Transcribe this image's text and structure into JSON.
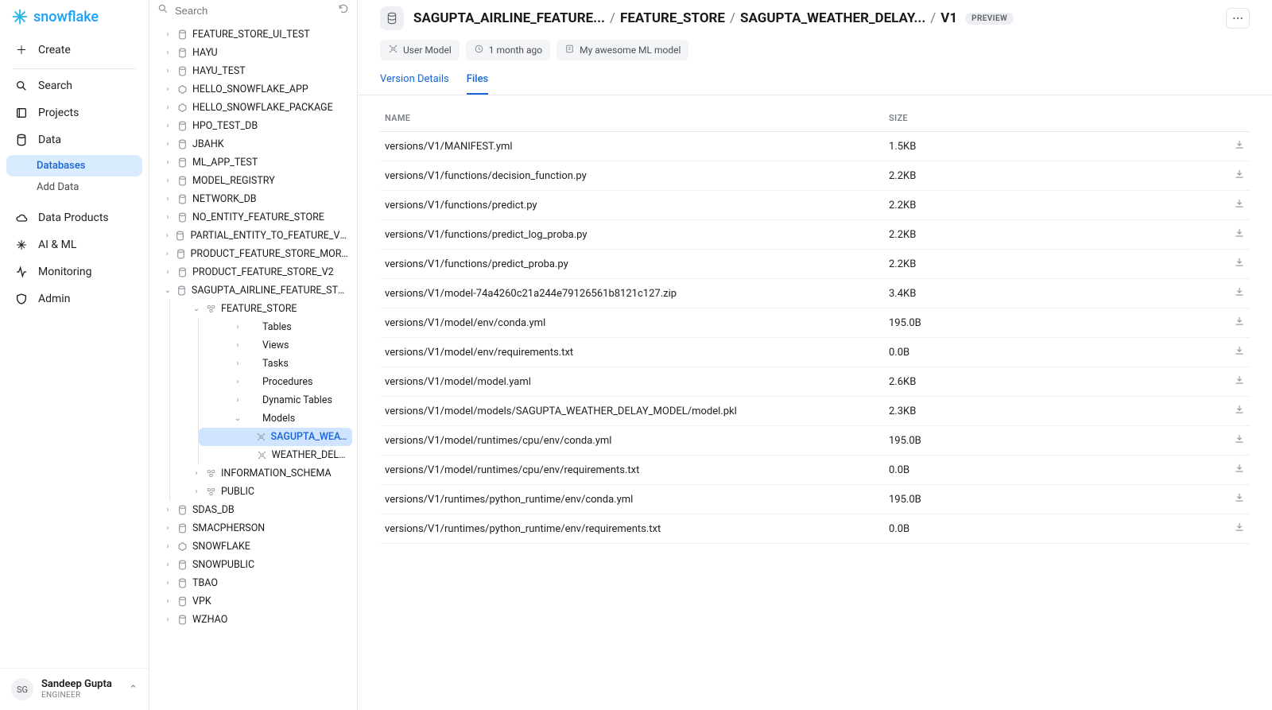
{
  "brand": "snowflake",
  "leftnav": {
    "create": "Create",
    "items": [
      {
        "label": "Search",
        "icon": "search"
      },
      {
        "label": "Projects",
        "icon": "projects"
      },
      {
        "label": "Data",
        "icon": "database"
      },
      {
        "label": "Data Products",
        "icon": "cloud"
      },
      {
        "label": "AI & ML",
        "icon": "sparkle"
      },
      {
        "label": "Monitoring",
        "icon": "activity"
      },
      {
        "label": "Admin",
        "icon": "shield"
      }
    ],
    "data_sub": [
      {
        "label": "Databases",
        "active": true
      },
      {
        "label": "Add Data",
        "active": false
      }
    ]
  },
  "user": {
    "initials": "SG",
    "name": "Sandeep Gupta",
    "role": "ENGINEER"
  },
  "tree": {
    "search_placeholder": "Search",
    "databases": [
      "FEATURE_STORE_UI_TEST",
      "HAYU",
      "HAYU_TEST",
      "HELLO_SNOWFLAKE_APP",
      "HELLO_SNOWFLAKE_PACKAGE",
      "HPO_TEST_DB",
      "JBAHK",
      "ML_APP_TEST",
      "MODEL_REGISTRY",
      "NETWORK_DB",
      "NO_ENTITY_FEATURE_STORE",
      "PARTIAL_ENTITY_TO_FEATURE_VIEW_LI...",
      "PRODUCT_FEATURE_STORE_MORE_ENT...",
      "PRODUCT_FEATURE_STORE_V2"
    ],
    "expanded_db": "SAGUPTA_AIRLINE_FEATURE_STORE",
    "schema": "FEATURE_STORE",
    "schema_children": [
      "Tables",
      "Views",
      "Tasks",
      "Procedures",
      "Dynamic Tables"
    ],
    "models_label": "Models",
    "models": {
      "selected": "SAGUPTA_WEATHER_DELAY_...",
      "other": "WEATHER_DELAY_MODEL"
    },
    "other_schemas": [
      "INFORMATION_SCHEMA",
      "PUBLIC"
    ],
    "databases_after": [
      "SDAS_DB",
      "SMACPHERSON",
      "SNOWFLAKE",
      "SNOWPUBLIC",
      "TBAO",
      "VPK",
      "WZHAO"
    ]
  },
  "header": {
    "crumbs": [
      "SAGUPTA_AIRLINE_FEATURE...",
      "FEATURE_STORE",
      "SAGUPTA_WEATHER_DELAY...",
      "V1"
    ],
    "preview": "PREVIEW",
    "chips": [
      {
        "icon": "model",
        "label": "User Model"
      },
      {
        "icon": "clock",
        "label": "1 month ago"
      },
      {
        "icon": "note",
        "label": "My awesome ML model"
      }
    ],
    "tabs": [
      {
        "label": "Version Details",
        "active": false
      },
      {
        "label": "Files",
        "active": true
      }
    ]
  },
  "table": {
    "columns": [
      "NAME",
      "SIZE"
    ],
    "rows": [
      {
        "name": "versions/V1/MANIFEST.yml",
        "size": "1.5KB"
      },
      {
        "name": "versions/V1/functions/decision_function.py",
        "size": "2.2KB"
      },
      {
        "name": "versions/V1/functions/predict.py",
        "size": "2.2KB"
      },
      {
        "name": "versions/V1/functions/predict_log_proba.py",
        "size": "2.2KB"
      },
      {
        "name": "versions/V1/functions/predict_proba.py",
        "size": "2.2KB"
      },
      {
        "name": "versions/V1/model-74a4260c21a244e79126561b8121c127.zip",
        "size": "3.4KB"
      },
      {
        "name": "versions/V1/model/env/conda.yml",
        "size": "195.0B"
      },
      {
        "name": "versions/V1/model/env/requirements.txt",
        "size": "0.0B"
      },
      {
        "name": "versions/V1/model/model.yaml",
        "size": "2.6KB"
      },
      {
        "name": "versions/V1/model/models/SAGUPTA_WEATHER_DELAY_MODEL/model.pkl",
        "size": "2.3KB"
      },
      {
        "name": "versions/V1/model/runtimes/cpu/env/conda.yml",
        "size": "195.0B"
      },
      {
        "name": "versions/V1/model/runtimes/cpu/env/requirements.txt",
        "size": "0.0B"
      },
      {
        "name": "versions/V1/runtimes/python_runtime/env/conda.yml",
        "size": "195.0B"
      },
      {
        "name": "versions/V1/runtimes/python_runtime/env/requirements.txt",
        "size": "0.0B"
      }
    ]
  }
}
